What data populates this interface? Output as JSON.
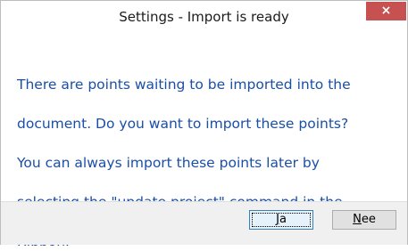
{
  "dialog": {
    "title": "Settings - Import is ready",
    "close_glyph": "×",
    "message_lines": [
      "There are points waiting to be imported into the",
      "document. Do you want to import these points?",
      "You can always import these points later by",
      "selecting the \"update project\" command in the",
      "Ribbon."
    ],
    "buttons": {
      "ja": {
        "mnemonic": "J",
        "rest": "a"
      },
      "nee": {
        "mnemonic": "N",
        "rest": "ee"
      }
    }
  },
  "colors": {
    "message_text": "#1a4fa8",
    "close_button": "#c75050"
  },
  "icons": {
    "close": "close-icon"
  }
}
